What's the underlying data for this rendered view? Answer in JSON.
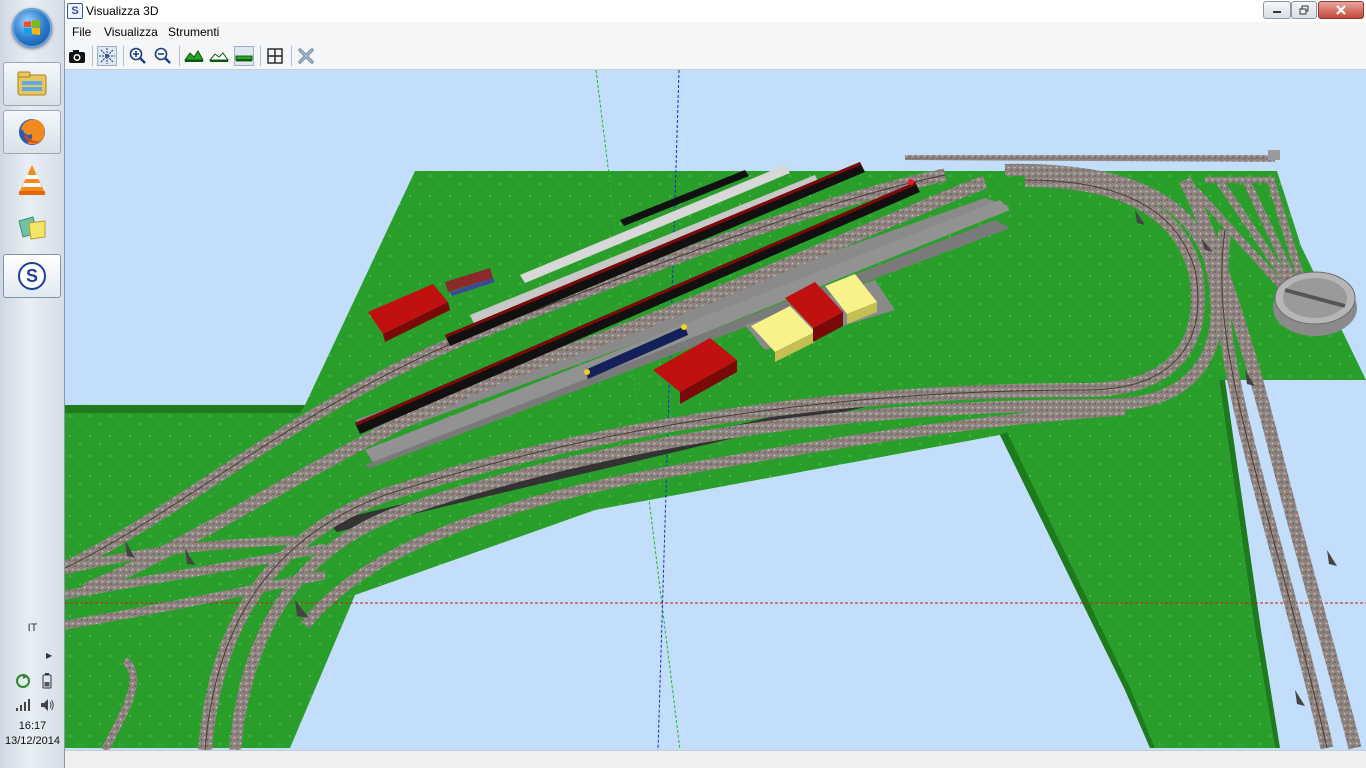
{
  "window": {
    "title": "Visualizza 3D",
    "app_icon_letter": "S"
  },
  "menu": {
    "file": "File",
    "visualizza": "Visualizza",
    "strumenti": "Strumenti"
  },
  "toolbar": {
    "icons": [
      "camera-icon",
      "axes-icon",
      "zoom-in-icon",
      "zoom-out-icon",
      "terrain-raise-icon",
      "terrain-lower-icon",
      "terrain-flat-icon",
      "fit-view-icon",
      "close-view-icon"
    ]
  },
  "taskbar": {
    "apps": [
      "file-explorer-icon",
      "firefox-icon",
      "vlc-icon",
      "photo-viewer-icon",
      "layout-app-icon"
    ],
    "language": "IT",
    "time": "16:17",
    "date": "13/12/2014"
  },
  "scene": {
    "sky_color": "#c3defa",
    "ground_color": "#2a9e2a",
    "track_color": "#8c8480",
    "platform_color": "#8a8a8a",
    "roof_red": "#b80f0f",
    "roof_yellow": "#f4f08a"
  }
}
